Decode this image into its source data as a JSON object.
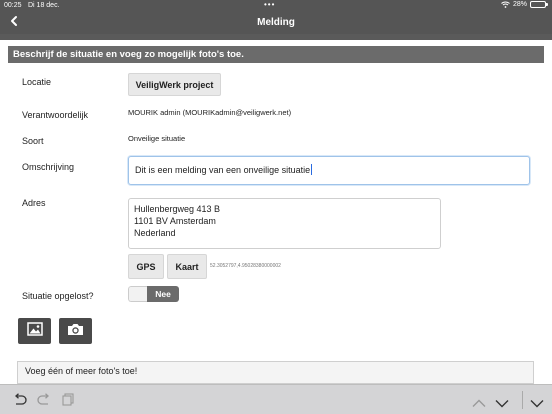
{
  "status_bar": {
    "time": "00:25",
    "date": "Di 18 dec.",
    "dots": "•••",
    "battery_text": "28%",
    "battery_level": 0.28
  },
  "nav": {
    "title": "Melding",
    "back_icon": "chevron-left-icon"
  },
  "banner": "Beschrijf de situatie en voeg zo mogelijk foto's toe.",
  "form": {
    "locatie": {
      "label": "Locatie",
      "button": "VeiligWerk project"
    },
    "verantwoordelijk": {
      "label": "Verantwoordelijk",
      "value": "MOURIK admin (MOURIKadmin@veiligwerk.net)"
    },
    "soort": {
      "label": "Soort",
      "value": "Onveilige situatie"
    },
    "omschrijving": {
      "label": "Omschrijving",
      "value": "Dit is een melding van een onveilige situatie"
    },
    "adres": {
      "label": "Adres",
      "lines": [
        "Hullenbergweg 413 B",
        "1101 BV Amsterdam",
        "Nederland"
      ],
      "gps_button": "GPS",
      "kaart_button": "Kaart",
      "coordinates": "52.3052797,4.95028380000002"
    },
    "opgelost": {
      "label": "Situatie opgelost?",
      "toggle_value": "Nee"
    },
    "photo_buttons": [
      {
        "icon": "image-icon"
      },
      {
        "icon": "camera-icon"
      }
    ],
    "photo_hint": "Voeg één of meer foto's toe!"
  },
  "keyboard_bar": {
    "left_icons": [
      "undo-icon",
      "redo-icon",
      "paste-icon"
    ],
    "right_icons": [
      "chevron-up-icon",
      "chevron-down-icon",
      "keyboard-dismiss-icon"
    ]
  }
}
